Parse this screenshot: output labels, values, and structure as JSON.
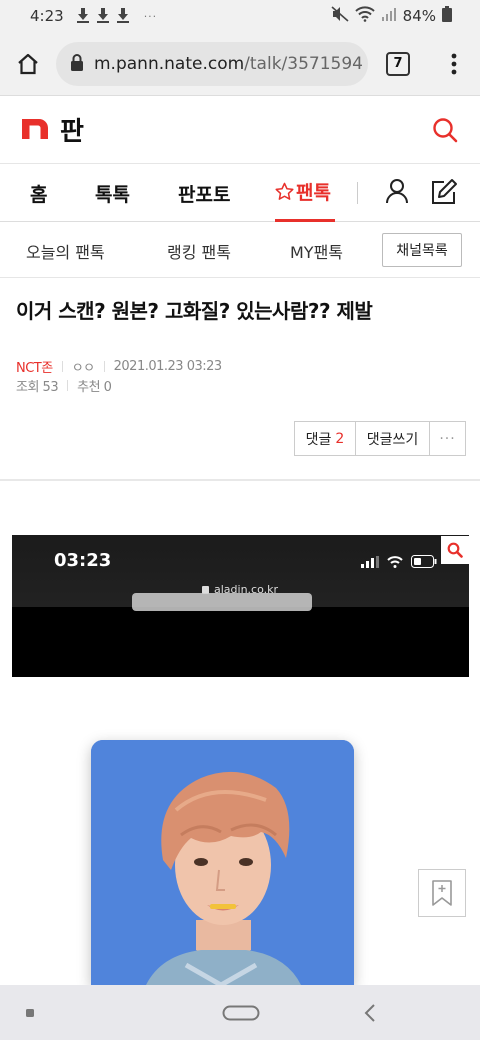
{
  "status_bar": {
    "time": "4:23",
    "battery": "84%",
    "icons": [
      "download-icon",
      "download-icon",
      "download-icon",
      "more-dots",
      "mute-icon",
      "wifi-icon",
      "signal-icon",
      "battery-icon"
    ]
  },
  "browser": {
    "url_host": "m.pann.nate.com",
    "url_path": "/talk/3571594",
    "tab_count": "7"
  },
  "site": {
    "logo_mark": "n",
    "logo_text": "판"
  },
  "main_nav": {
    "items": [
      {
        "label": "홈"
      },
      {
        "label": "톡톡"
      },
      {
        "label": "판포토"
      },
      {
        "label": "팬톡",
        "active": true
      }
    ]
  },
  "sub_nav": {
    "items": [
      {
        "label": "오늘의 팬톡"
      },
      {
        "label": "랭킹 팬톡"
      },
      {
        "label": "MY팬톡"
      }
    ],
    "channel_button": "채널목록"
  },
  "article": {
    "title": "이거 스캔? 원본? 고화질? 있는사람?? 제발",
    "category": "NCT존",
    "author": "ㅇㅇ",
    "date": "2021.01.23 03:23",
    "views": "조회 53",
    "recommends": "추천 0",
    "comments_label": "댓글",
    "comments_count": "2",
    "write_comment": "댓글쓰기",
    "more": "···"
  },
  "embed": {
    "time": "03:23",
    "url": "aladin.co.kr"
  },
  "colors": {
    "brand": "#e8302b",
    "card_bg": "#4a7fd8"
  }
}
